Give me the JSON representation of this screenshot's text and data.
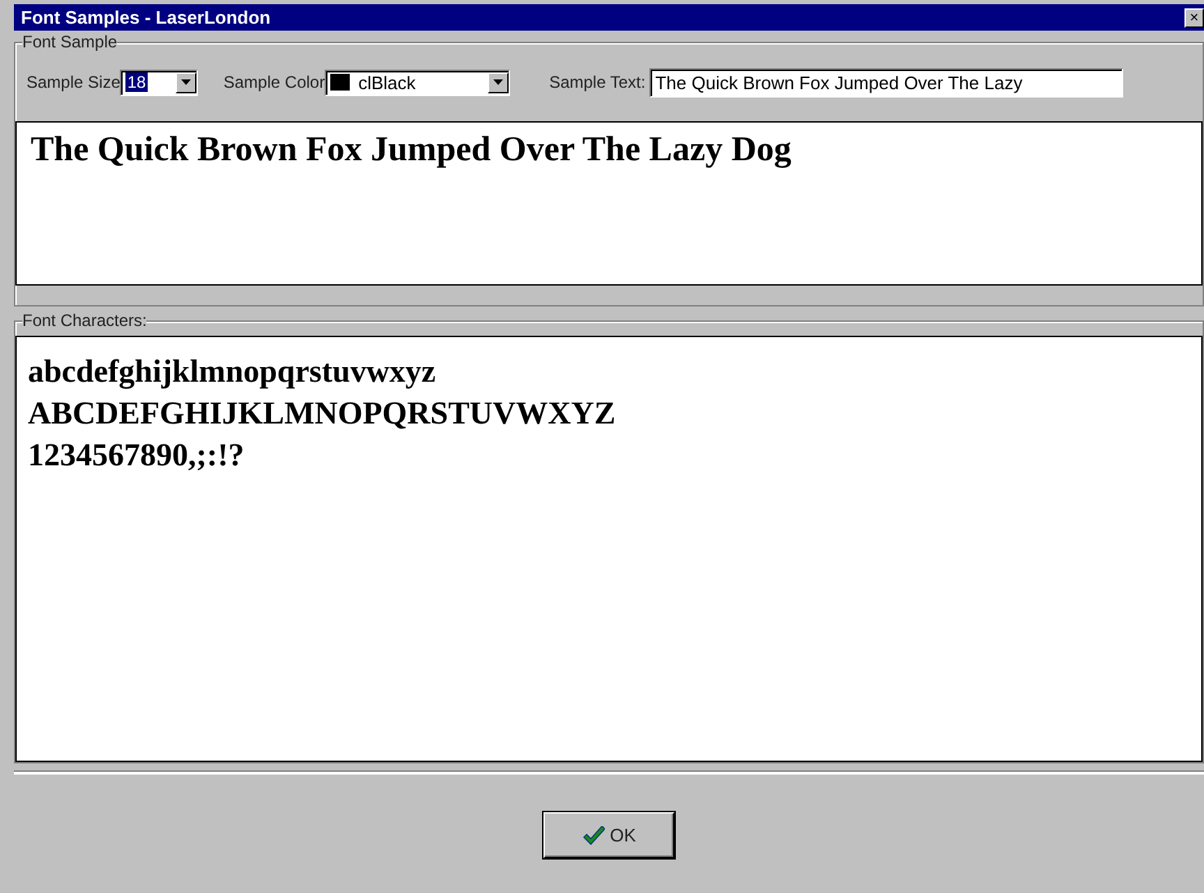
{
  "window": {
    "title": "Font Samples - LaserLondon",
    "close": "×"
  },
  "font_sample": {
    "legend": "Font Sample",
    "size": {
      "label": "Sample Size",
      "value": "18",
      "selected": true
    },
    "color": {
      "label": "Sample Color",
      "value": "clBlack",
      "color": "#000000"
    },
    "text": {
      "label": "Sample Text:",
      "value": "The Quick Brown Fox Jumped Over The Lazy"
    },
    "preview": "The Quick Brown Fox Jumped Over The Lazy Dog"
  },
  "font_characters": {
    "legend": "Font Characters:",
    "lines": [
      "abcdefghijklmnopqrstuvwxyz",
      "ABCDEFGHIJKLMNOPQRSTUVWXYZ",
      "1234567890,;:!?"
    ]
  },
  "buttons": [
    {
      "label": "OK",
      "kind": "ok"
    }
  ]
}
